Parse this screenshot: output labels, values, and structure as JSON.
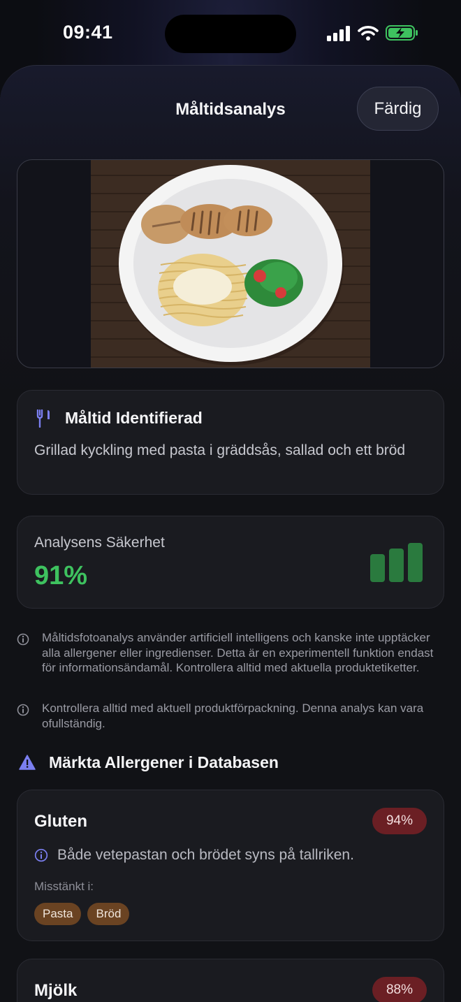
{
  "status": {
    "time": "09:41"
  },
  "header": {
    "title": "Måltidsanalys",
    "done_label": "Färdig"
  },
  "meal": {
    "title": "Måltid Identifierad",
    "description": "Grillad kyckling med pasta i gräddsås, sallad och ett bröd",
    "icon": "fork-knife-icon"
  },
  "confidence": {
    "label": "Analysens Säkerhet",
    "value": "91%",
    "color": "#3ec25f"
  },
  "notes": [
    {
      "text": "Måltidsfotoanalys använder artificiell intelligens och kanske inte upptäcker alla allergener eller ingredienser. Detta är en experimentell funktion endast för informationsändamål. Kontrollera alltid med aktuella produktetiketter."
    },
    {
      "text": "Kontrollera alltid med aktuell produktförpackning. Denna analys kan vara ofullständig."
    }
  ],
  "allergens": {
    "heading": "Märkta Allergener i Databasen",
    "items": [
      {
        "name": "Gluten",
        "badge": "94%",
        "reason": "Både vetepastan och brödet syns på tallriken.",
        "suspected_label": "Misstänkt i:",
        "chips": [
          "Pasta",
          "Bröd"
        ]
      },
      {
        "name": "Mjölk",
        "badge": "88%"
      }
    ]
  },
  "colors": {
    "accent": "#7b7ff0",
    "badge": "#6b1f24",
    "chip": "#6a4322",
    "success": "#3ec25f"
  }
}
